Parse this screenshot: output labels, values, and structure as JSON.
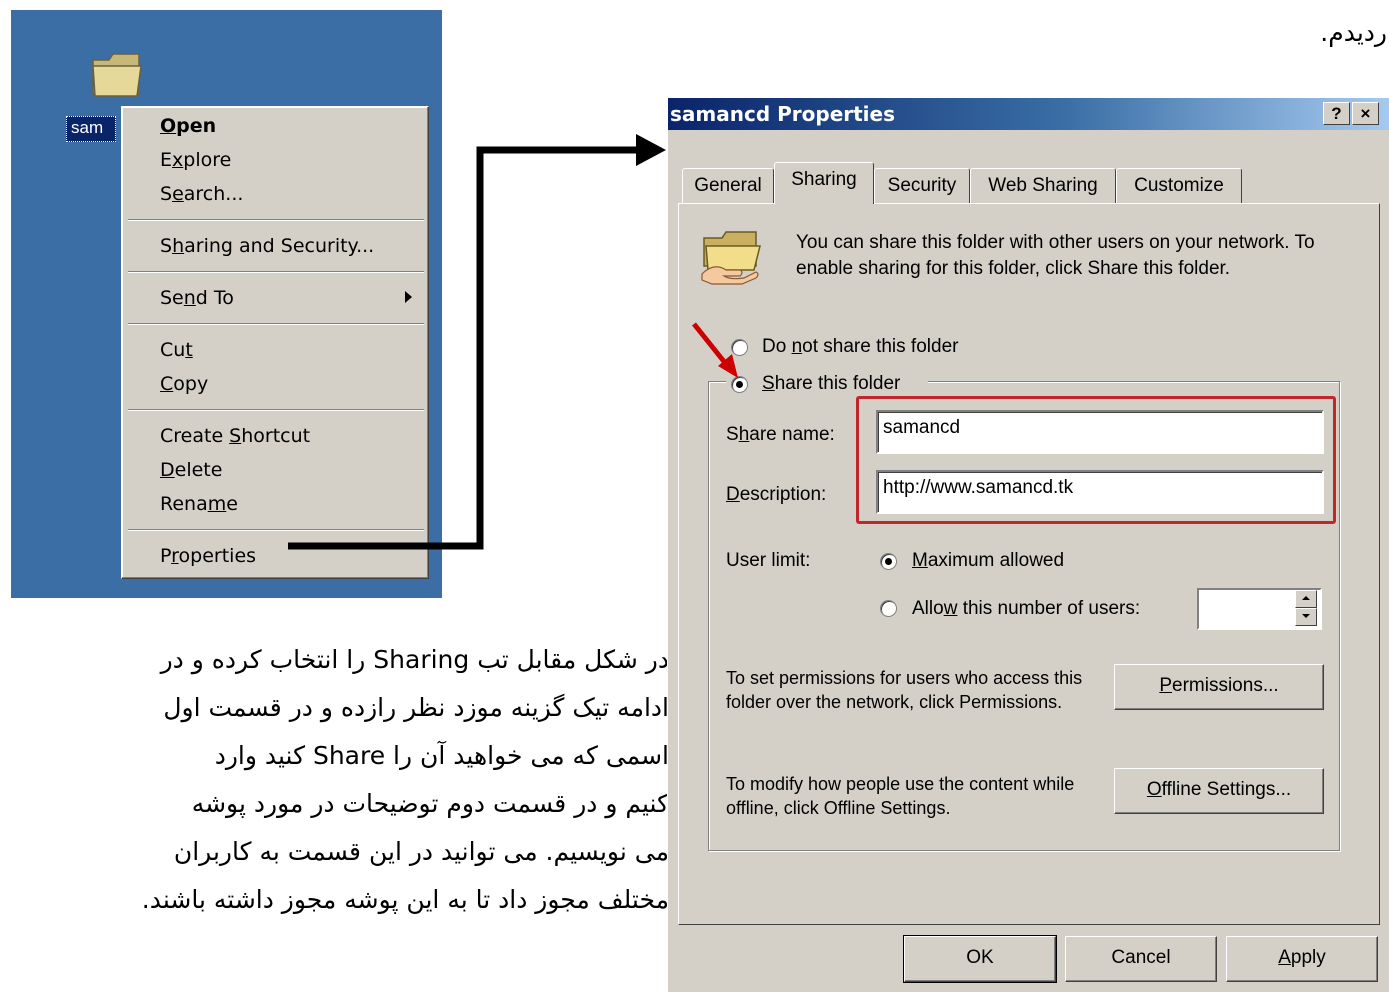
{
  "document": {
    "top_text": "ردیدم.",
    "paragraph_lines": [
      "در شکل مقابل تب Sharing را انتخاب کرده و در",
      "ادامه تیک گزینه موزد نظر رازده و در قسمت اول",
      "اسمی که می خواهید آن را Share کنید وارد",
      "کنیم و در قسمت دوم توضیحات در مورد پوشه",
      "می نویسیم. می توانید در این قسمت به کاربران",
      "مختلف مجوز داد تا به  این پوشه مجوز داشته باشند."
    ]
  },
  "desktop": {
    "icon_label": "sam",
    "icon": "folder-icon",
    "background_color": "#3a6ea5"
  },
  "context_menu": {
    "items": [
      {
        "pre": "",
        "u": "O",
        "post": "pen"
      },
      {
        "pre": "E",
        "u": "x",
        "post": "plore"
      },
      {
        "pre": "S",
        "u": "e",
        "post": "arch..."
      },
      {
        "pre": "S",
        "u": "h",
        "post": "aring and Security..."
      },
      {
        "pre": "Se",
        "u": "n",
        "post": "d To"
      },
      {
        "pre": "Cu",
        "u": "t",
        "post": ""
      },
      {
        "pre": "",
        "u": "C",
        "post": "opy"
      },
      {
        "pre": "Create ",
        "u": "S",
        "post": "hortcut"
      },
      {
        "pre": "",
        "u": "D",
        "post": "elete"
      },
      {
        "pre": "Rena",
        "u": "m",
        "post": "e"
      },
      {
        "pre": "P",
        "u": "r",
        "post": "operties"
      }
    ]
  },
  "dialog": {
    "title": "samancd Properties",
    "help_button": "?",
    "close_button": "×",
    "tabs": [
      "General",
      "Sharing",
      "Security",
      "Web Sharing",
      "Customize"
    ],
    "active_tab": "Sharing",
    "info_text": "You can share this folder with other users on your network.  To enable sharing for this folder, click Share this folder.",
    "radio_do_not_share": {
      "pre": "Do ",
      "u": "n",
      "post": "ot share this folder"
    },
    "radio_share": {
      "pre": "",
      "u": "S",
      "post": "hare this folder"
    },
    "share_name_label": {
      "pre": "S",
      "u": "h",
      "post": "are name:"
    },
    "share_name_value": "samancd",
    "description_label": {
      "pre": "",
      "u": "D",
      "post": "escription:"
    },
    "description_value": "http://www.samancd.tk",
    "user_limit_label": "User limit:",
    "max_allowed": {
      "pre": "",
      "u": "M",
      "post": "aximum allowed"
    },
    "allow_number": {
      "pre": "Allo",
      "u": "w",
      "post": " this number of users:"
    },
    "user_count_value": "",
    "permissions_text": "To set permissions for users who access this folder over the network, click Permissions.",
    "permissions_button": {
      "pre": "",
      "u": "P",
      "post": "ermissions..."
    },
    "offline_text": "To modify how people use the content while offline, click Offline Settings.",
    "offline_button": {
      "pre": "",
      "u": "O",
      "post": "ffline Settings..."
    },
    "ok_button": "OK",
    "cancel_button": "Cancel",
    "apply_button": {
      "pre": "",
      "u": "A",
      "post": "pply"
    },
    "colors": {
      "title_gradient_start": "#0a246a",
      "highlight_box": "#c0272d",
      "annotation_arrow": "#cc0000"
    }
  }
}
